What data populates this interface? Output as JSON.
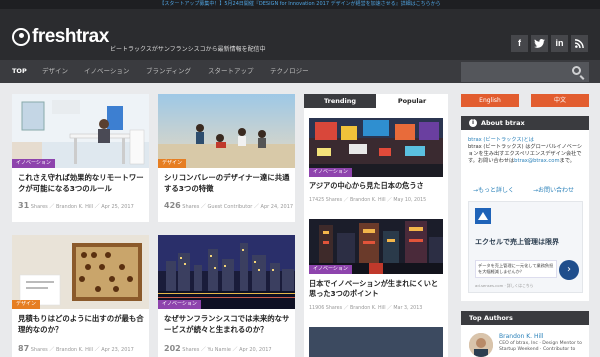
{
  "announcement": "【スタートアップ募集中！】5月24日開催『DESIGN for Innovation 2017 デザインが経営を加速させる』詳細はこちらから",
  "header": {
    "logo": "freshtrax",
    "tagline": "ビートラックスがサンフランシスコから最新情報を配信中",
    "social": [
      "f",
      "t",
      "in",
      "rss"
    ]
  },
  "nav": {
    "items": [
      "TOP",
      "デザイン",
      "イノベーション",
      "ブランディング",
      "スタートアップ",
      "テクノロジー"
    ],
    "search_placeholder": ""
  },
  "articles": [
    {
      "category": "イノベーション",
      "title": "これさえ守れば効果的なリモートワークが可能になる3つのルール",
      "shares": "31",
      "shares_label": "Shares",
      "author": "Brandon K. Hill",
      "date": "Apr 25, 2017"
    },
    {
      "category": "デザイン",
      "title": "シリコンバレーのデザイナー達に共通する3つの特徴",
      "shares": "426",
      "shares_label": "Shares",
      "author": "Guest Contributor",
      "date": "Apr 24, 2017"
    },
    {
      "category": "デザイン",
      "title": "見積もりはどのように出すのが最も合理的なのか？",
      "shares": "87",
      "shares_label": "Shares",
      "author": "Brandon K. Hill",
      "date": "Apr 23, 2017"
    },
    {
      "category": "イノベーション",
      "title": "なぜサンフランシスコでは未来的なサービスが続々と生まれるのか？",
      "shares": "202",
      "shares_label": "Shares",
      "author": "Yu Namie",
      "date": "Apr 20, 2017"
    }
  ],
  "sidebar_tabs": {
    "trending": "Trending",
    "popular": "Popular"
  },
  "popular": [
    {
      "category": "イノベーション",
      "title": "アジアの中心から見た日本の危うさ",
      "meta": "17425 Shares ／ Brandon K. Hill ／ May 10, 2015"
    },
    {
      "category": "イノベーション",
      "title": "日本でイノベーションが生まれにくいと思った3つのポイント",
      "meta": "11906 Shares ／ Brandon K. Hill ／ Mar 3, 2013"
    }
  ],
  "lang": {
    "en": "English",
    "zh": "中文"
  },
  "about": {
    "heading": "About btrax",
    "text_link": "btrax (ビートラックス)とは",
    "text_body": "btrax (ビートラックス) はグローバルイノベーションを生み出すエクスペリエンスデザイン会社です。お問い合わせは",
    "email": "btrax@btrax.com",
    "text_end": "まで。",
    "more": "→もっと詳しく",
    "contact": "→お問い合わせ"
  },
  "ad": {
    "title": "エクセルで売上管理は限界",
    "box": "データを売上管理に一元化して業務負担を大幅軽減しませんか？",
    "go": "›",
    "footer": "ad.senses.com · 詳しくはこちら"
  },
  "authors": {
    "heading": "Top Authors",
    "name": "Brandon K. Hill",
    "desc": "CEO of btrax, Inc · Design Mentor to Startup Weekend · Contributor to"
  },
  "colors": {
    "accent": "#e25d2f",
    "category_purple": "#8e44ad",
    "category_orange": "#e67e22",
    "dark": "#2b2c2f",
    "link": "#2980b9"
  }
}
